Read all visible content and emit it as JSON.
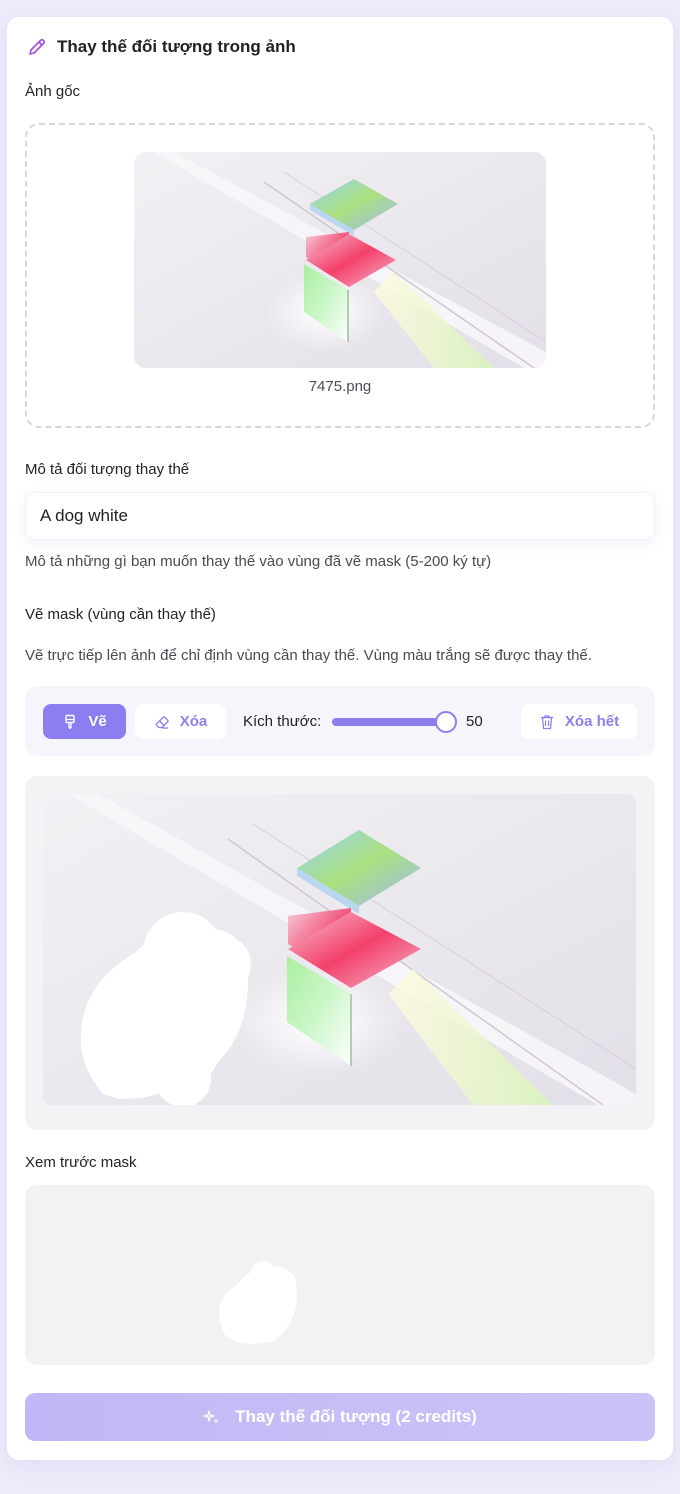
{
  "header": {
    "title": "Thay thế đối tượng trong ảnh",
    "icon": "pencil-icon"
  },
  "original": {
    "label": "Ảnh gốc",
    "filename": "7475.png"
  },
  "description": {
    "label": "Mô tả đối tượng thay thế",
    "value": "A dog white",
    "hint": "Mô tả những gì bạn muốn thay thế vào vùng đã vẽ mask (5-200 ký tự)"
  },
  "mask": {
    "label": "Vẽ mask (vùng cần thay thế)",
    "hint": "Vẽ trực tiếp lên ảnh để chỉ định vùng cần thay thế. Vùng màu trắng sẽ được thay thế.",
    "draw_label": "Vẽ",
    "erase_label": "Xóa",
    "size_label": "Kích thước:",
    "size_value": "50",
    "size_fraction": 1.0,
    "clear_label": "Xóa hết"
  },
  "preview": {
    "label": "Xem trước mask"
  },
  "submit": {
    "label": "Thay thế đối tượng (2 credits)"
  },
  "colors": {
    "accent": "#8b7ef0",
    "accent_light": "#c5bdf6",
    "background": "#eeecfb"
  }
}
